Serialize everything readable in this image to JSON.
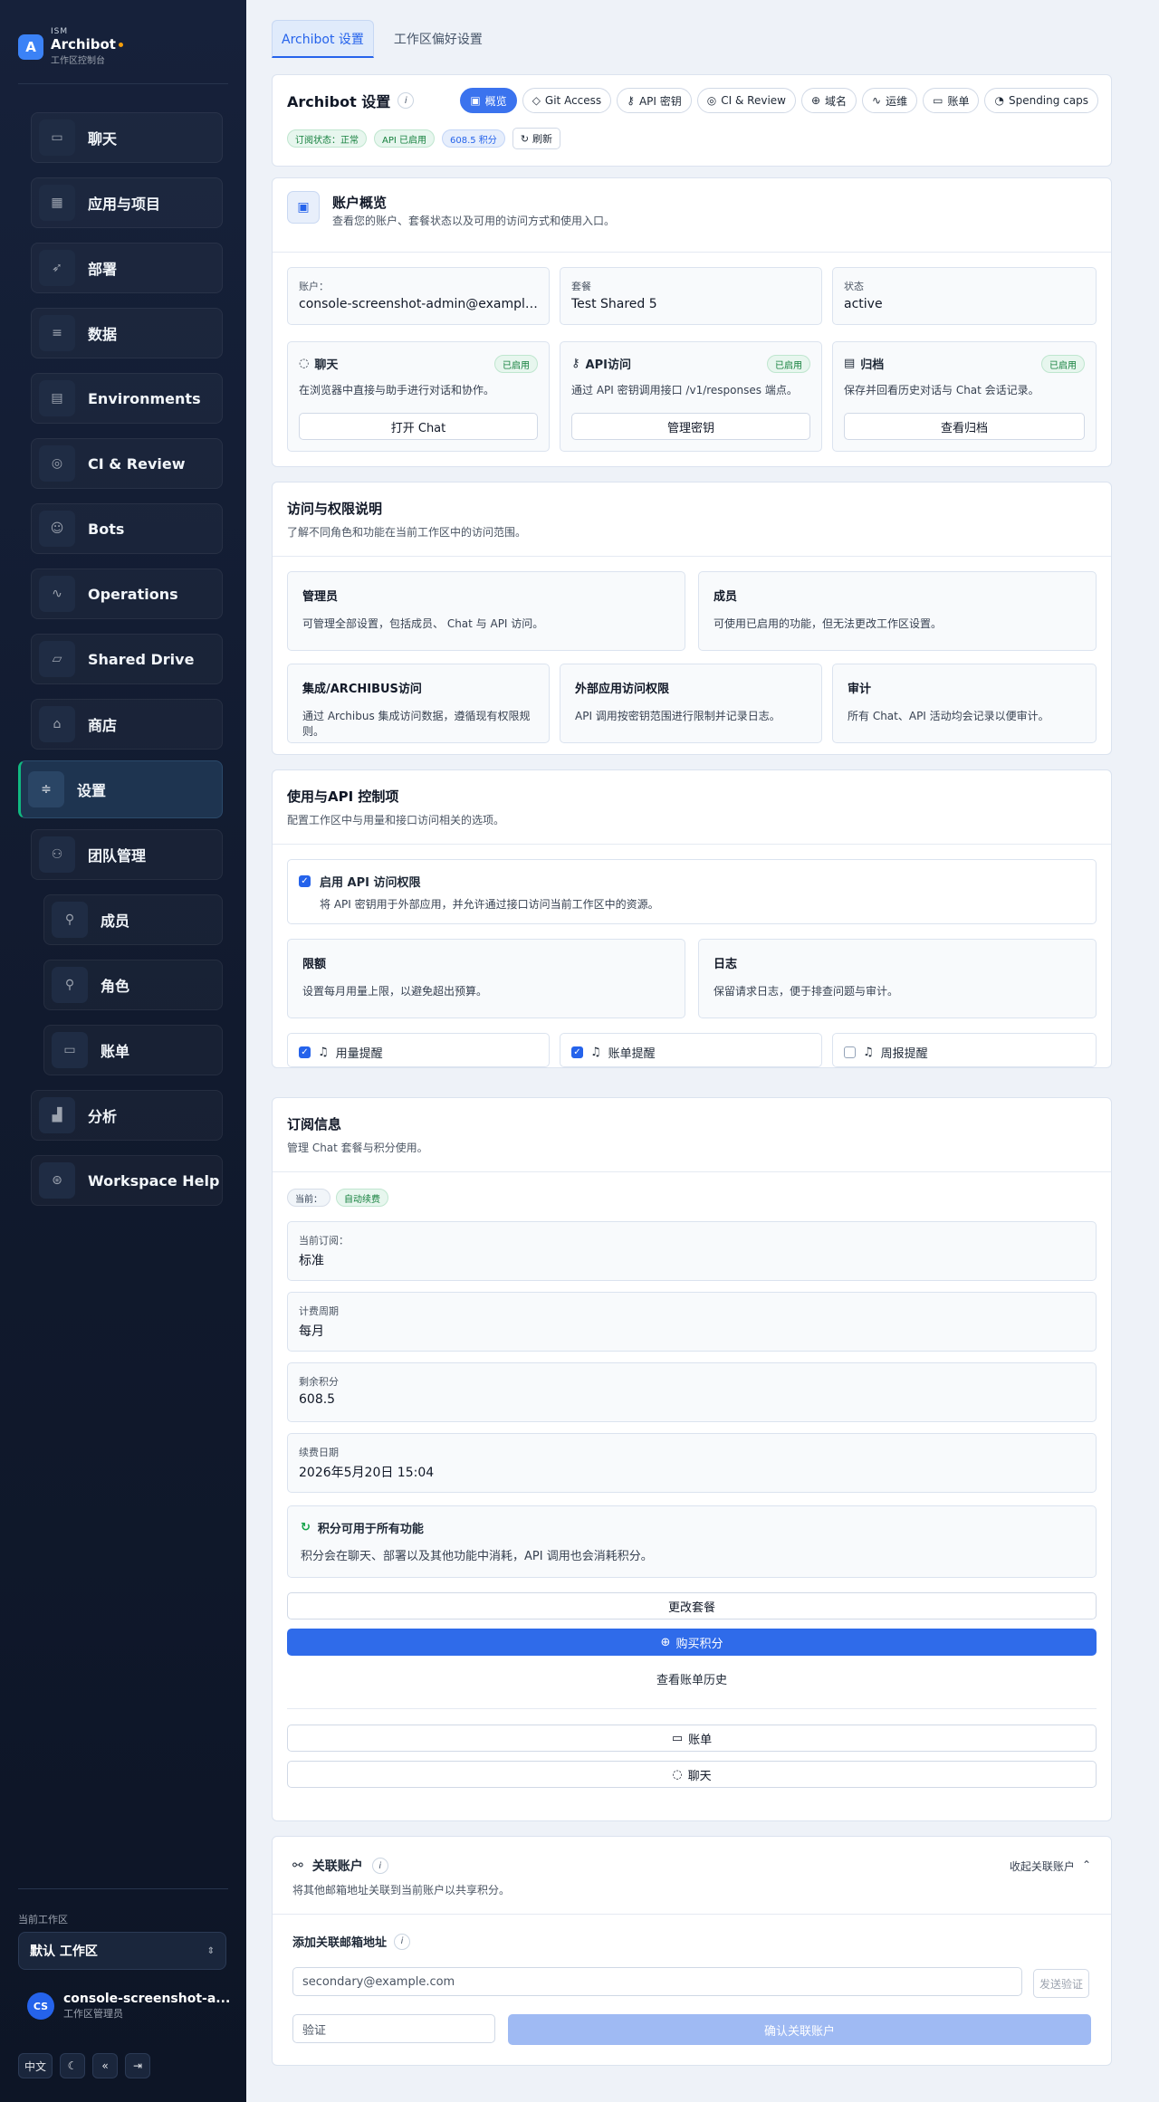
{
  "brand": {
    "kicker": "ISM",
    "name": "Archibot",
    "subtitle": "工作区控制台"
  },
  "sidebar": {
    "items": [
      {
        "label": "聊天",
        "icon": "chat-icon"
      },
      {
        "label": "应用与项目",
        "icon": "apps-icon"
      },
      {
        "label": "部署",
        "icon": "rocket-icon"
      },
      {
        "label": "数据",
        "icon": "database-icon"
      },
      {
        "label": "Environments",
        "icon": "server-icon"
      },
      {
        "label": "CI & Review",
        "icon": "check-circle-icon"
      },
      {
        "label": "Bots",
        "icon": "bot-icon"
      },
      {
        "label": "Operations",
        "icon": "activity-icon"
      },
      {
        "label": "Shared Drive",
        "icon": "folder-icon"
      },
      {
        "label": "商店",
        "icon": "store-icon"
      },
      {
        "label": "设置",
        "icon": "sliders-icon"
      },
      {
        "label": "团队管理",
        "icon": "team-icon"
      },
      {
        "label": "成员",
        "icon": "user-icon"
      },
      {
        "label": "角色",
        "icon": "user-icon"
      },
      {
        "label": "账单",
        "icon": "card-icon"
      },
      {
        "label": "分析",
        "icon": "chart-icon"
      },
      {
        "label": "Workspace Help",
        "icon": "help-icon"
      }
    ],
    "workspace_label": "当前工作区",
    "workspace_value": "默认 工作区",
    "user_initials": "CS",
    "user_name": "console-screenshot-a...",
    "user_role": "工作区管理员",
    "footer_lang": "中文"
  },
  "tabs": [
    "Archibot 设置",
    "工作区偏好设置"
  ],
  "header": {
    "title": "Archibot 设置",
    "pills": [
      "概览",
      "Git Access",
      "API 密钥",
      "CI & Review",
      "域名",
      "运维",
      "账单",
      "Spending caps"
    ],
    "badges": [
      "订阅状态：正常",
      "API 已启用",
      "608.5 积分"
    ],
    "sync_label": "刷新"
  },
  "overview": {
    "title": "账户概览",
    "subtitle": "查看您的账户、套餐状态以及可用的访问方式和使用入口。",
    "account_label": "账户：",
    "account_value": "console-screenshot-admin@example.com",
    "plan_label": "套餐",
    "plan_value": "Test Shared 5",
    "status_label": "状态",
    "status_value": "active",
    "modes": [
      {
        "title": "聊天",
        "badge": "已启用",
        "desc": "在浏览器中直接与助手进行对话和协作。",
        "button": "打开 Chat",
        "icon": "chat-icon"
      },
      {
        "title": "API访问",
        "badge": "已启用",
        "desc": "通过 API 密钥调用接口 /v1/responses 端点。",
        "button": "管理密钥",
        "icon": "key-icon"
      },
      {
        "title": "归档",
        "badge": "已启用",
        "desc": "保存并回看历史对话与 Chat 会话记录。",
        "button": "查看归档",
        "icon": "archive-icon"
      }
    ]
  },
  "permissions": {
    "title": "访问与权限说明",
    "subtitle": "了解不同角色和功能在当前工作区中的访问范围。",
    "cards": [
      {
        "title": "管理员",
        "desc": "可管理全部设置，包括成员、 Chat 与 API 访问。"
      },
      {
        "title": "成员",
        "desc": "可使用已启用的功能，但无法更改工作区设置。"
      },
      {
        "title": "集成/ARCHIBUS访问",
        "desc": "通过 Archibus 集成访问数据，遵循现有权限规则。"
      },
      {
        "title": "外部应用访问权限",
        "desc": "API 调用按密钥范围进行限制并记录日志。"
      },
      {
        "title": "审计",
        "desc": "所有 Chat、API 活动均会记录以便审计。"
      }
    ]
  },
  "controls": {
    "title": "使用与API 控制项",
    "subtitle": "配置工作区中与用量和接口访问相关的选项。",
    "api_toggle_title": "启用 API 访问权限",
    "api_toggle_desc": "将 API 密钥用于外部应用，并允许通过接口访问当前工作区中的资源。",
    "cards": [
      {
        "title": "限额",
        "desc": "设置每月用量上限，以避免超出预算。"
      },
      {
        "title": "日志",
        "desc": "保留请求日志，便于排查问题与审计。"
      }
    ],
    "notify": [
      {
        "label": "用量提醒",
        "checked": true
      },
      {
        "label": "账单提醒",
        "checked": true
      },
      {
        "label": "周报提醒",
        "checked": false
      }
    ]
  },
  "subscription": {
    "title": "订阅信息",
    "subtitle": "管理 Chat 套餐与积分使用。",
    "badges": [
      "当前：",
      "自动续费"
    ],
    "fields": [
      {
        "label": "当前订阅：",
        "value": "标准"
      },
      {
        "label": "计费周期",
        "value": "每月"
      },
      {
        "label": "剩余积分",
        "value": "608.5"
      },
      {
        "label": "续费日期",
        "value": "2026年5月20日 15:04"
      }
    ],
    "notice_title": "积分可用于所有功能",
    "notice_desc": "积分会在聊天、部署以及其他功能中消耗，API 调用也会消耗积分。",
    "btn_change": "更改套餐",
    "btn_buy": "购买积分",
    "btn_history_link": "查看账单历史",
    "btn_billing": "账单",
    "btn_chat": "聊天"
  },
  "linked": {
    "title": "关联账户",
    "subtitle": "将其他邮箱地址关联到当前账户以共享积分。",
    "toggle_label": "收起关联账户",
    "field_title": "添加关联邮箱地址",
    "email_placeholder": "secondary@example.com",
    "send_label": "发送验证",
    "code_placeholder": "验证",
    "confirm_label": "确认关联账户"
  }
}
